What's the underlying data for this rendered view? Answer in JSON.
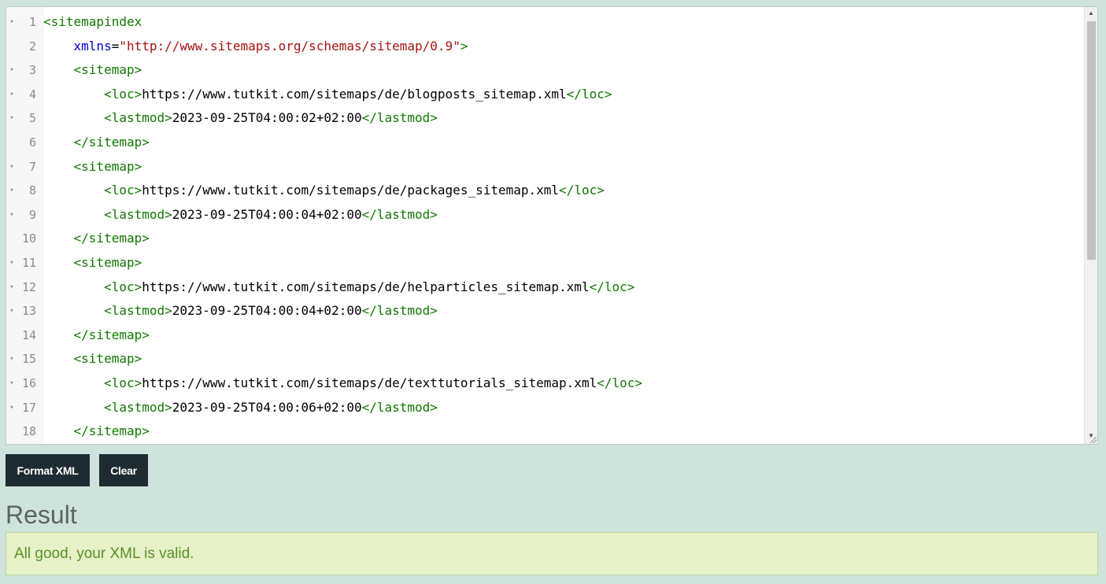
{
  "editor": {
    "fold_marker": "▾",
    "lines": [
      {
        "n": "1",
        "fold": true,
        "parts": [
          {
            "t": "tag",
            "v": "<sitemapindex"
          }
        ]
      },
      {
        "n": "2",
        "fold": false,
        "parts": [
          {
            "t": "attr",
            "v": "    xmlns"
          },
          {
            "t": "txt",
            "v": "="
          },
          {
            "t": "str",
            "v": "\"http://www.sitemaps.org/schemas/sitemap/0.9\""
          },
          {
            "t": "tag",
            "v": ">"
          }
        ]
      },
      {
        "n": "3",
        "fold": true,
        "parts": [
          {
            "t": "tag",
            "v": "    <sitemap>"
          }
        ]
      },
      {
        "n": "4",
        "fold": true,
        "parts": [
          {
            "t": "tag",
            "v": "        <loc>"
          },
          {
            "t": "txt",
            "v": "https://www.tutkit.com/sitemaps/de/blogposts_sitemap.xml"
          },
          {
            "t": "tag",
            "v": "</loc>"
          }
        ]
      },
      {
        "n": "5",
        "fold": true,
        "parts": [
          {
            "t": "tag",
            "v": "        <lastmod>"
          },
          {
            "t": "txt",
            "v": "2023-09-25T04:00:02+02:00"
          },
          {
            "t": "tag",
            "v": "</lastmod>"
          }
        ]
      },
      {
        "n": "6",
        "fold": false,
        "parts": [
          {
            "t": "tag",
            "v": "    </sitemap>"
          }
        ]
      },
      {
        "n": "7",
        "fold": true,
        "parts": [
          {
            "t": "tag",
            "v": "    <sitemap>"
          }
        ]
      },
      {
        "n": "8",
        "fold": true,
        "parts": [
          {
            "t": "tag",
            "v": "        <loc>"
          },
          {
            "t": "txt",
            "v": "https://www.tutkit.com/sitemaps/de/packages_sitemap.xml"
          },
          {
            "t": "tag",
            "v": "</loc>"
          }
        ]
      },
      {
        "n": "9",
        "fold": true,
        "parts": [
          {
            "t": "tag",
            "v": "        <lastmod>"
          },
          {
            "t": "txt",
            "v": "2023-09-25T04:00:04+02:00"
          },
          {
            "t": "tag",
            "v": "</lastmod>"
          }
        ]
      },
      {
        "n": "10",
        "fold": false,
        "parts": [
          {
            "t": "tag",
            "v": "    </sitemap>"
          }
        ]
      },
      {
        "n": "11",
        "fold": true,
        "parts": [
          {
            "t": "tag",
            "v": "    <sitemap>"
          }
        ]
      },
      {
        "n": "12",
        "fold": true,
        "parts": [
          {
            "t": "tag",
            "v": "        <loc>"
          },
          {
            "t": "txt",
            "v": "https://www.tutkit.com/sitemaps/de/helparticles_sitemap.xml"
          },
          {
            "t": "tag",
            "v": "</loc>"
          }
        ]
      },
      {
        "n": "13",
        "fold": true,
        "parts": [
          {
            "t": "tag",
            "v": "        <lastmod>"
          },
          {
            "t": "txt",
            "v": "2023-09-25T04:00:04+02:00"
          },
          {
            "t": "tag",
            "v": "</lastmod>"
          }
        ]
      },
      {
        "n": "14",
        "fold": false,
        "parts": [
          {
            "t": "tag",
            "v": "    </sitemap>"
          }
        ]
      },
      {
        "n": "15",
        "fold": true,
        "parts": [
          {
            "t": "tag",
            "v": "    <sitemap>"
          }
        ]
      },
      {
        "n": "16",
        "fold": true,
        "parts": [
          {
            "t": "tag",
            "v": "        <loc>"
          },
          {
            "t": "txt",
            "v": "https://www.tutkit.com/sitemaps/de/texttutorials_sitemap.xml"
          },
          {
            "t": "tag",
            "v": "</loc>"
          }
        ]
      },
      {
        "n": "17",
        "fold": true,
        "parts": [
          {
            "t": "tag",
            "v": "        <lastmod>"
          },
          {
            "t": "txt",
            "v": "2023-09-25T04:00:06+02:00"
          },
          {
            "t": "tag",
            "v": "</lastmod>"
          }
        ]
      },
      {
        "n": "18",
        "fold": false,
        "parts": [
          {
            "t": "tag",
            "v": "    </sitemap>"
          }
        ]
      }
    ]
  },
  "toolbar": {
    "format_label": "Format XML",
    "clear_label": "Clear"
  },
  "result": {
    "title": "Result",
    "message": "All good, your XML is valid."
  },
  "colors": {
    "background": "#cfe3dd",
    "button": "#1f2b33",
    "tag": "#117700",
    "attribute": "#0000cc",
    "string": "#aa1111",
    "success_bg": "#e6f1c7",
    "success_text": "#5c8f2a"
  },
  "icons": {
    "fold": "caret-down-icon",
    "scroll_up": "scroll-up-arrow-icon",
    "scroll_down": "scroll-down-arrow-icon",
    "resize": "resize-grip-icon"
  }
}
